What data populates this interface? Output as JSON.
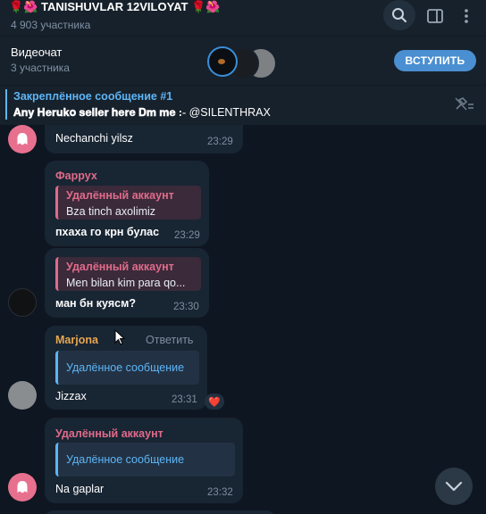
{
  "header": {
    "title": "🌹🌺 TANISHUVLAR 12VILOYAT 🌹🌺",
    "subtitle": "4 903 участника"
  },
  "videochat": {
    "title": "Видеочат",
    "subtitle": "3 участника",
    "join_label": "ВСТУПИТЬ"
  },
  "pinned": {
    "title": "Закреплённое сообщение #1",
    "text_bold": "𝐀𝐧𝐲 𝐇𝐞𝐫𝐮𝐤𝐨 𝐬𝐞𝐥𝐥𝐞𝐫 𝐡𝐞𝐫𝐞  𝐃𝐦 𝐦𝐞 :-",
    "text_handle": " @SILENTHRAX"
  },
  "messages": [
    {
      "body": "Nechanchi  yilsz",
      "time": "23:29"
    },
    {
      "sender": "Фаррух",
      "sender_color": "#e06b8a",
      "quote_name": "Удалённый аккаунт",
      "quote_text": "Bza tinch  axolimiz",
      "body": "пхаха го крн булас",
      "time": "23:29"
    },
    {
      "quote_name": "Удалённый аккаунт",
      "quote_text": "Men bilan kim para qo...",
      "body": "ман бн куясм?",
      "time": "23:30"
    },
    {
      "sender": "Marjona",
      "sender_color": "#e8a64f",
      "reply_label": "Ответить",
      "quote_text": "Удалённое сообщение",
      "body": "Jizzax",
      "time": "23:31",
      "reaction": "❤️"
    },
    {
      "sender": "Удалённый аккаунт",
      "sender_color": "#e06b8a",
      "quote_text": "Удалённое сообщение",
      "body": "Na  gaplar",
      "time": "23:32"
    }
  ],
  "colors": {
    "accent": "#5eb5f7",
    "deleted_account": "#e06b8a",
    "join_button": "#4a8fd1"
  },
  "icons": [
    "search-icon",
    "sidebar-icon",
    "more-icon",
    "unpin-icon",
    "ghost-icon",
    "chevron-down-icon",
    "heart-icon"
  ]
}
